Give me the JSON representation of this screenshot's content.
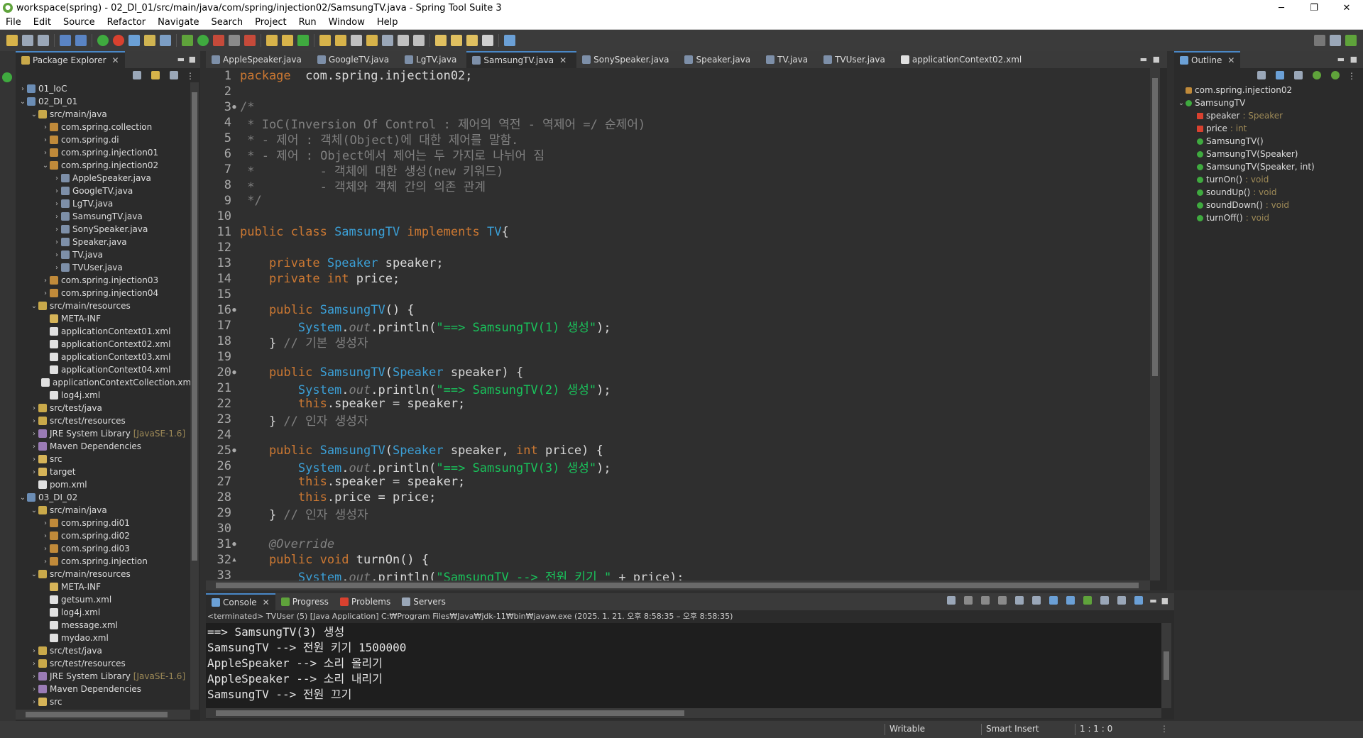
{
  "window": {
    "title": "workspace(spring) - 02_DI_01/src/main/java/com/spring/injection02/SamsungTV.java - Spring Tool Suite 3",
    "min": "─",
    "max": "❐",
    "close": "✕"
  },
  "menu": [
    "File",
    "Edit",
    "Source",
    "Refactor",
    "Navigate",
    "Search",
    "Project",
    "Run",
    "Window",
    "Help"
  ],
  "package_explorer": {
    "title": "Package Explorer",
    "tree": [
      {
        "label": "01_IoC",
        "indent": 0,
        "arrow": "›",
        "icon": "proj"
      },
      {
        "label": "02_DI_01",
        "indent": 0,
        "arrow": "⌄",
        "icon": "proj"
      },
      {
        "label": "src/main/java",
        "indent": 1,
        "arrow": "⌄",
        "icon": "src"
      },
      {
        "label": "com.spring.collection",
        "indent": 2,
        "arrow": "›",
        "icon": "pkg"
      },
      {
        "label": "com.spring.di",
        "indent": 2,
        "arrow": "›",
        "icon": "pkg"
      },
      {
        "label": "com.spring.injection01",
        "indent": 2,
        "arrow": "›",
        "icon": "pkg"
      },
      {
        "label": "com.spring.injection02",
        "indent": 2,
        "arrow": "⌄",
        "icon": "pkg"
      },
      {
        "label": "AppleSpeaker.java",
        "indent": 3,
        "arrow": "›",
        "icon": "java"
      },
      {
        "label": "GoogleTV.java",
        "indent": 3,
        "arrow": "›",
        "icon": "java"
      },
      {
        "label": "LgTV.java",
        "indent": 3,
        "arrow": "›",
        "icon": "java"
      },
      {
        "label": "SamsungTV.java",
        "indent": 3,
        "arrow": "›",
        "icon": "java"
      },
      {
        "label": "SonySpeaker.java",
        "indent": 3,
        "arrow": "›",
        "icon": "java"
      },
      {
        "label": "Speaker.java",
        "indent": 3,
        "arrow": "›",
        "icon": "java"
      },
      {
        "label": "TV.java",
        "indent": 3,
        "arrow": "›",
        "icon": "java"
      },
      {
        "label": "TVUser.java",
        "indent": 3,
        "arrow": "›",
        "icon": "java"
      },
      {
        "label": "com.spring.injection03",
        "indent": 2,
        "arrow": "›",
        "icon": "pkg"
      },
      {
        "label": "com.spring.injection04",
        "indent": 2,
        "arrow": "›",
        "icon": "pkg"
      },
      {
        "label": "src/main/resources",
        "indent": 1,
        "arrow": "⌄",
        "icon": "src"
      },
      {
        "label": "META-INF",
        "indent": 2,
        "arrow": "",
        "icon": "folder"
      },
      {
        "label": "applicationContext01.xml",
        "indent": 2,
        "arrow": "",
        "icon": "xml"
      },
      {
        "label": "applicationContext02.xml",
        "indent": 2,
        "arrow": "",
        "icon": "xml"
      },
      {
        "label": "applicationContext03.xml",
        "indent": 2,
        "arrow": "",
        "icon": "xml"
      },
      {
        "label": "applicationContext04.xml",
        "indent": 2,
        "arrow": "",
        "icon": "xml"
      },
      {
        "label": "applicationContextCollection.xml",
        "indent": 2,
        "arrow": "",
        "icon": "xml"
      },
      {
        "label": "log4j.xml",
        "indent": 2,
        "arrow": "",
        "icon": "xml"
      },
      {
        "label": "src/test/java",
        "indent": 1,
        "arrow": "›",
        "icon": "src"
      },
      {
        "label": "src/test/resources",
        "indent": 1,
        "arrow": "›",
        "icon": "src"
      },
      {
        "label": "JRE System Library",
        "suffix": "[JavaSE-1.6]",
        "indent": 1,
        "arrow": "›",
        "icon": "lib"
      },
      {
        "label": "Maven Dependencies",
        "indent": 1,
        "arrow": "›",
        "icon": "lib"
      },
      {
        "label": "src",
        "indent": 1,
        "arrow": "›",
        "icon": "folder"
      },
      {
        "label": "target",
        "indent": 1,
        "arrow": "›",
        "icon": "folder"
      },
      {
        "label": "pom.xml",
        "indent": 1,
        "arrow": "",
        "icon": "xml"
      },
      {
        "label": "03_DI_02",
        "indent": 0,
        "arrow": "⌄",
        "icon": "proj"
      },
      {
        "label": "src/main/java",
        "indent": 1,
        "arrow": "⌄",
        "icon": "src"
      },
      {
        "label": "com.spring.di01",
        "indent": 2,
        "arrow": "›",
        "icon": "pkg"
      },
      {
        "label": "com.spring.di02",
        "indent": 2,
        "arrow": "›",
        "icon": "pkg"
      },
      {
        "label": "com.spring.di03",
        "indent": 2,
        "arrow": "›",
        "icon": "pkg"
      },
      {
        "label": "com.spring.injection",
        "indent": 2,
        "arrow": "›",
        "icon": "pkg"
      },
      {
        "label": "src/main/resources",
        "indent": 1,
        "arrow": "⌄",
        "icon": "src"
      },
      {
        "label": "META-INF",
        "indent": 2,
        "arrow": "",
        "icon": "folder"
      },
      {
        "label": "getsum.xml",
        "indent": 2,
        "arrow": "",
        "icon": "xml"
      },
      {
        "label": "log4j.xml",
        "indent": 2,
        "arrow": "",
        "icon": "xml"
      },
      {
        "label": "message.xml",
        "indent": 2,
        "arrow": "",
        "icon": "xml"
      },
      {
        "label": "mydao.xml",
        "indent": 2,
        "arrow": "",
        "icon": "xml"
      },
      {
        "label": "src/test/java",
        "indent": 1,
        "arrow": "›",
        "icon": "src"
      },
      {
        "label": "src/test/resources",
        "indent": 1,
        "arrow": "›",
        "icon": "src"
      },
      {
        "label": "JRE System Library",
        "suffix": "[JavaSE-1.6]",
        "indent": 1,
        "arrow": "›",
        "icon": "lib"
      },
      {
        "label": "Maven Dependencies",
        "indent": 1,
        "arrow": "›",
        "icon": "lib"
      },
      {
        "label": "src",
        "indent": 1,
        "arrow": "›",
        "icon": "folder"
      }
    ]
  },
  "editor": {
    "tabs": [
      {
        "label": "AppleSpeaker.java",
        "active": false
      },
      {
        "label": "GoogleTV.java",
        "active": false
      },
      {
        "label": "LgTV.java",
        "active": false
      },
      {
        "label": "SamsungTV.java",
        "active": true
      },
      {
        "label": "SonySpeaker.java",
        "active": false
      },
      {
        "label": "Speaker.java",
        "active": false
      },
      {
        "label": "TV.java",
        "active": false
      },
      {
        "label": "TVUser.java",
        "active": false
      },
      {
        "label": "applicationContext02.xml",
        "active": false
      }
    ],
    "lines": [
      {
        "n": "1",
        "m": "",
        "t": [
          [
            "kw",
            "package"
          ],
          [
            "",
            "  com.spring.injection02;"
          ]
        ]
      },
      {
        "n": "2",
        "m": "",
        "t": []
      },
      {
        "n": "3",
        "m": "●",
        "t": [
          [
            "cmt",
            "/*"
          ]
        ]
      },
      {
        "n": "4",
        "m": "",
        "t": [
          [
            "cmt",
            " * IoC(Inversion Of Control : 제어의 역전 - 역제어 =/ 순제어)"
          ]
        ]
      },
      {
        "n": "5",
        "m": "",
        "t": [
          [
            "cmt",
            " * - 제어 : 객체(Object)에 대한 제어를 말함."
          ]
        ]
      },
      {
        "n": "6",
        "m": "",
        "t": [
          [
            "cmt",
            " * - 제어 : Object에서 제어는 두 가지로 나뉘어 짐"
          ]
        ]
      },
      {
        "n": "7",
        "m": "",
        "t": [
          [
            "cmt",
            " *         - 객체에 대한 생성(new 키워드)"
          ]
        ]
      },
      {
        "n": "8",
        "m": "",
        "t": [
          [
            "cmt",
            " *         - 객체와 객체 간의 의존 관계"
          ]
        ]
      },
      {
        "n": "9",
        "m": "",
        "t": [
          [
            "cmt",
            " */"
          ]
        ]
      },
      {
        "n": "10",
        "m": "",
        "t": []
      },
      {
        "n": "11",
        "m": "",
        "t": [
          [
            "kw",
            "public class "
          ],
          [
            "cls",
            "SamsungTV"
          ],
          [
            "kw",
            " implements "
          ],
          [
            "cls",
            "TV"
          ],
          [
            "",
            "{"
          ]
        ]
      },
      {
        "n": "12",
        "m": "",
        "t": []
      },
      {
        "n": "13",
        "m": "",
        "t": [
          [
            "kw",
            "    private "
          ],
          [
            "cls",
            "Speaker "
          ],
          [
            "fld",
            "speaker"
          ],
          [
            "",
            ";"
          ]
        ]
      },
      {
        "n": "14",
        "m": "",
        "t": [
          [
            "kw",
            "    private int "
          ],
          [
            "fld",
            "price"
          ],
          [
            "",
            ";"
          ]
        ]
      },
      {
        "n": "15",
        "m": "",
        "t": []
      },
      {
        "n": "16",
        "m": "●",
        "t": [
          [
            "kw",
            "    public "
          ],
          [
            "cls",
            "SamsungTV"
          ],
          [
            "",
            "() {"
          ]
        ]
      },
      {
        "n": "17",
        "m": "",
        "t": [
          [
            "cls",
            "        System"
          ],
          [
            "",
            "."
          ],
          [
            "ann",
            "out"
          ],
          [
            "",
            ".println("
          ],
          [
            "str",
            "\"==> SamsungTV(1) 생성\""
          ],
          [
            "",
            ");"
          ]
        ]
      },
      {
        "n": "18",
        "m": "",
        "t": [
          [
            "",
            "    } "
          ],
          [
            "cmt",
            "// 기본 생성자"
          ]
        ]
      },
      {
        "n": "19",
        "m": "",
        "t": []
      },
      {
        "n": "20",
        "m": "●",
        "t": [
          [
            "kw",
            "    public "
          ],
          [
            "cls",
            "SamsungTV"
          ],
          [
            "",
            "("
          ],
          [
            "cls",
            "Speaker "
          ],
          [
            "fld",
            "speaker"
          ],
          [
            "",
            ") {"
          ]
        ]
      },
      {
        "n": "21",
        "m": "",
        "t": [
          [
            "cls",
            "        System"
          ],
          [
            "",
            "."
          ],
          [
            "ann",
            "out"
          ],
          [
            "",
            ".println("
          ],
          [
            "str",
            "\"==> SamsungTV(2) 생성\""
          ],
          [
            "",
            ");"
          ]
        ]
      },
      {
        "n": "22",
        "m": "",
        "t": [
          [
            "kw",
            "        this"
          ],
          [
            "",
            ".speaker = speaker;"
          ]
        ]
      },
      {
        "n": "23",
        "m": "",
        "t": [
          [
            "",
            "    } "
          ],
          [
            "cmt",
            "// 인자 생성자"
          ]
        ]
      },
      {
        "n": "24",
        "m": "",
        "t": []
      },
      {
        "n": "25",
        "m": "●",
        "t": [
          [
            "kw",
            "    public "
          ],
          [
            "cls",
            "SamsungTV"
          ],
          [
            "",
            "("
          ],
          [
            "cls",
            "Speaker "
          ],
          [
            "fld",
            "speaker"
          ],
          [
            "",
            ", "
          ],
          [
            "kw",
            "int "
          ],
          [
            "fld",
            "price"
          ],
          [
            "",
            ") {"
          ]
        ]
      },
      {
        "n": "26",
        "m": "",
        "t": [
          [
            "cls",
            "        System"
          ],
          [
            "",
            "."
          ],
          [
            "ann",
            "out"
          ],
          [
            "",
            ".println("
          ],
          [
            "str",
            "\"==> SamsungTV(3) 생성\""
          ],
          [
            "",
            ");"
          ]
        ]
      },
      {
        "n": "27",
        "m": "",
        "t": [
          [
            "kw",
            "        this"
          ],
          [
            "",
            ".speaker = speaker;"
          ]
        ]
      },
      {
        "n": "28",
        "m": "",
        "t": [
          [
            "kw",
            "        this"
          ],
          [
            "",
            ".price = price;"
          ]
        ]
      },
      {
        "n": "29",
        "m": "",
        "t": [
          [
            "",
            "    } "
          ],
          [
            "cmt",
            "// 인자 생성자"
          ]
        ]
      },
      {
        "n": "30",
        "m": "",
        "t": []
      },
      {
        "n": "31",
        "m": "●",
        "t": [
          [
            "ann",
            "    @Override"
          ]
        ]
      },
      {
        "n": "32",
        "m": "▲",
        "t": [
          [
            "kw",
            "    public void "
          ],
          [
            "mth",
            "turnOn"
          ],
          [
            "",
            "() {"
          ]
        ]
      },
      {
        "n": "33",
        "m": "",
        "t": [
          [
            "cls",
            "        System"
          ],
          [
            "",
            "."
          ],
          [
            "ann",
            "out"
          ],
          [
            "",
            ".println("
          ],
          [
            "str",
            "\"SamsungTV --> 전원 키기 \""
          ],
          [
            "",
            " + price);"
          ]
        ]
      }
    ]
  },
  "outline": {
    "title": "Outline",
    "items": [
      {
        "label": "com.spring.injection02",
        "type": "",
        "indent": 0,
        "icon": "pkg",
        "arrow": ""
      },
      {
        "label": "SamsungTV",
        "type": "",
        "indent": 0,
        "icon": "class",
        "arrow": "⌄"
      },
      {
        "label": "speaker",
        "type": ": Speaker",
        "indent": 1,
        "icon": "field",
        "arrow": ""
      },
      {
        "label": "price",
        "type": ": int",
        "indent": 1,
        "icon": "field",
        "arrow": ""
      },
      {
        "label": "SamsungTV()",
        "type": "",
        "indent": 1,
        "icon": "method",
        "arrow": ""
      },
      {
        "label": "SamsungTV(Speaker)",
        "type": "",
        "indent": 1,
        "icon": "method",
        "arrow": ""
      },
      {
        "label": "SamsungTV(Speaker, int)",
        "type": "",
        "indent": 1,
        "icon": "method",
        "arrow": ""
      },
      {
        "label": "turnOn()",
        "type": ": void",
        "indent": 1,
        "icon": "method",
        "arrow": ""
      },
      {
        "label": "soundUp()",
        "type": ": void",
        "indent": 1,
        "icon": "method",
        "arrow": ""
      },
      {
        "label": "soundDown()",
        "type": ": void",
        "indent": 1,
        "icon": "method",
        "arrow": ""
      },
      {
        "label": "turnOff()",
        "type": ": void",
        "indent": 1,
        "icon": "method",
        "arrow": ""
      }
    ]
  },
  "console": {
    "tabs": [
      {
        "label": "Console",
        "active": true
      },
      {
        "label": "Progress",
        "active": false
      },
      {
        "label": "Problems",
        "active": false
      },
      {
        "label": "Servers",
        "active": false
      }
    ],
    "info": "<terminated> TVUser (5) [Java Application] C:₩Program Files₩Java₩jdk-11₩bin₩javaw.exe  (2025. 1. 21. 오후 8:58:35 – 오후 8:58:35)",
    "lines": [
      "==> SamsungTV(3) 생성",
      "SamsungTV --> 전원 키기 1500000",
      "AppleSpeaker --> 소리 올리기",
      "AppleSpeaker --> 소리 내리기",
      "SamsungTV --> 전원 끄기"
    ]
  },
  "status": {
    "writable": "Writable",
    "insert_mode": "Smart Insert",
    "position": "1 : 1 : 0"
  },
  "colors": {
    "keyword": "#cc7832",
    "class": "#3b9fd6",
    "string": "#19c35b",
    "comment": "#808080"
  }
}
